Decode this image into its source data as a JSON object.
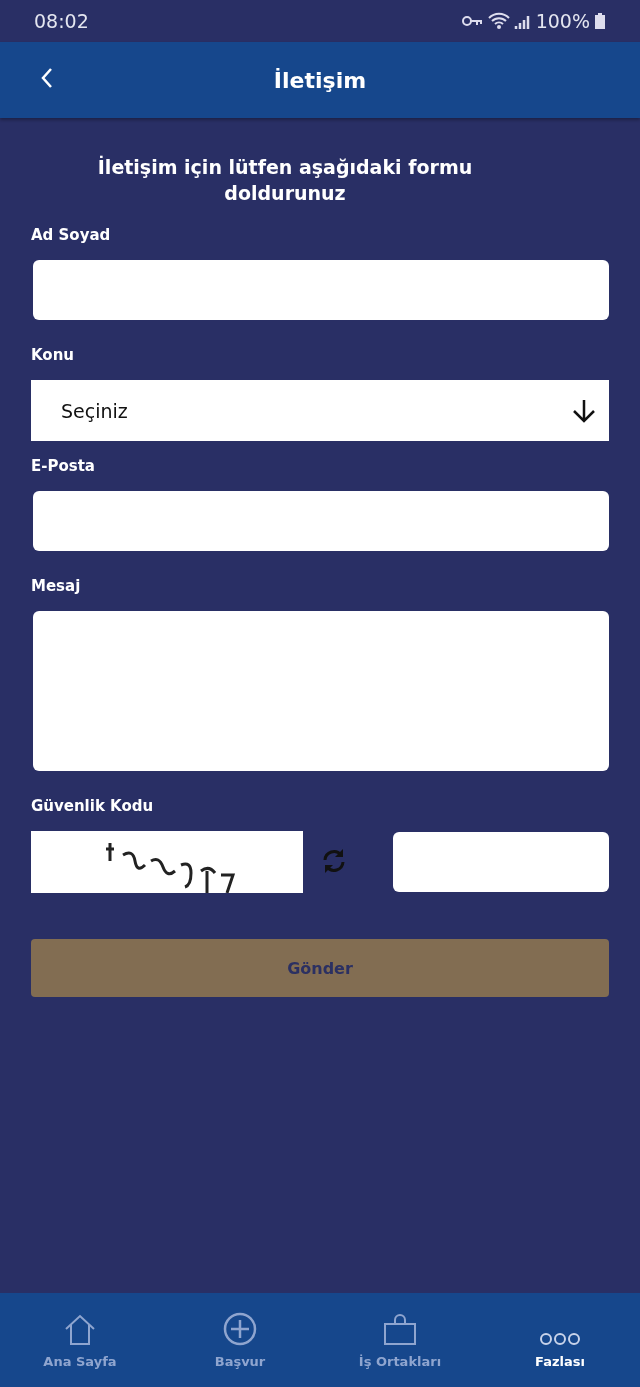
{
  "status_bar": {
    "time": "08:02",
    "battery": "100%"
  },
  "header": {
    "title": "İletişim"
  },
  "intro": "İletişim için lütfen aşağıdaki formu doldurunuz",
  "fields": [
    {
      "label": "Ad Soyad",
      "kind": "text"
    },
    {
      "label": "Konu",
      "kind": "select",
      "value": "Seçiniz"
    },
    {
      "label": "E-Posta",
      "kind": "text"
    },
    {
      "label": "Mesaj",
      "kind": "textarea"
    }
  ],
  "captcha": {
    "label": "Güvenlik Kodu",
    "kind": "picture"
  },
  "submit": "Gönder",
  "nav": [
    {
      "label": "Ana Sayfa",
      "selected": false
    },
    {
      "label": "Başvur",
      "selected": false
    },
    {
      "label": "İş Ortakları",
      "selected": false
    },
    {
      "label": "Fazlası",
      "selected": true
    }
  ]
}
